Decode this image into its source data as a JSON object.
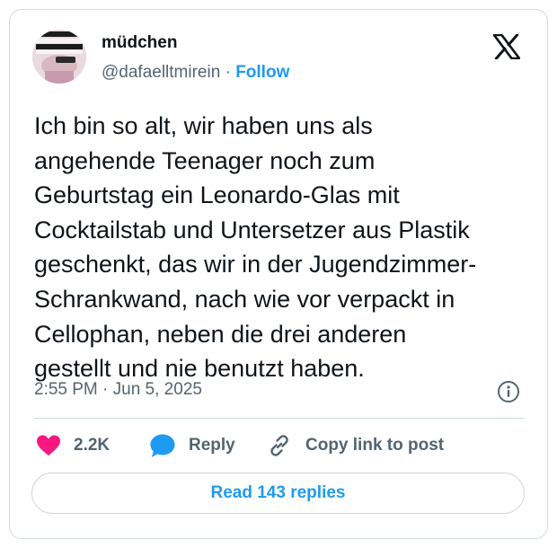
{
  "author": {
    "name": "müdchen",
    "handle": "@dafaelltmirein",
    "separator": "·",
    "follow_label": "Follow"
  },
  "tweet": {
    "lines": [
      "Ich bin so alt, wir haben uns als",
      "angehende Teenager noch zum",
      "Geburtstag ein Leonardo-Glas mit",
      "Cocktailstab und Untersetzer aus Plastik",
      "geschenkt, das wir in der Jugendzimmer-",
      "Schrankwand, nach wie vor verpackt in",
      "Cellophan, neben die drei anderen",
      "gestellt und nie benutzt haben."
    ],
    "timestamp": "2:55 PM · Jun 5, 2025"
  },
  "actions": {
    "like_count": "2.2K",
    "reply_label": "Reply",
    "copy_label": "Copy link to post",
    "read_replies_label": "Read 143 replies"
  },
  "icons": {
    "avatar": "avatar-photo",
    "logo": "x-logo-icon",
    "info": "info-icon",
    "like": "heart-icon",
    "reply": "speech-bubble-icon",
    "copy": "link-icon"
  },
  "colors": {
    "accent": "#1d9bf0",
    "like": "#f91880",
    "muted": "#536471",
    "text": "#0f1419",
    "border": "#cfd9de"
  }
}
